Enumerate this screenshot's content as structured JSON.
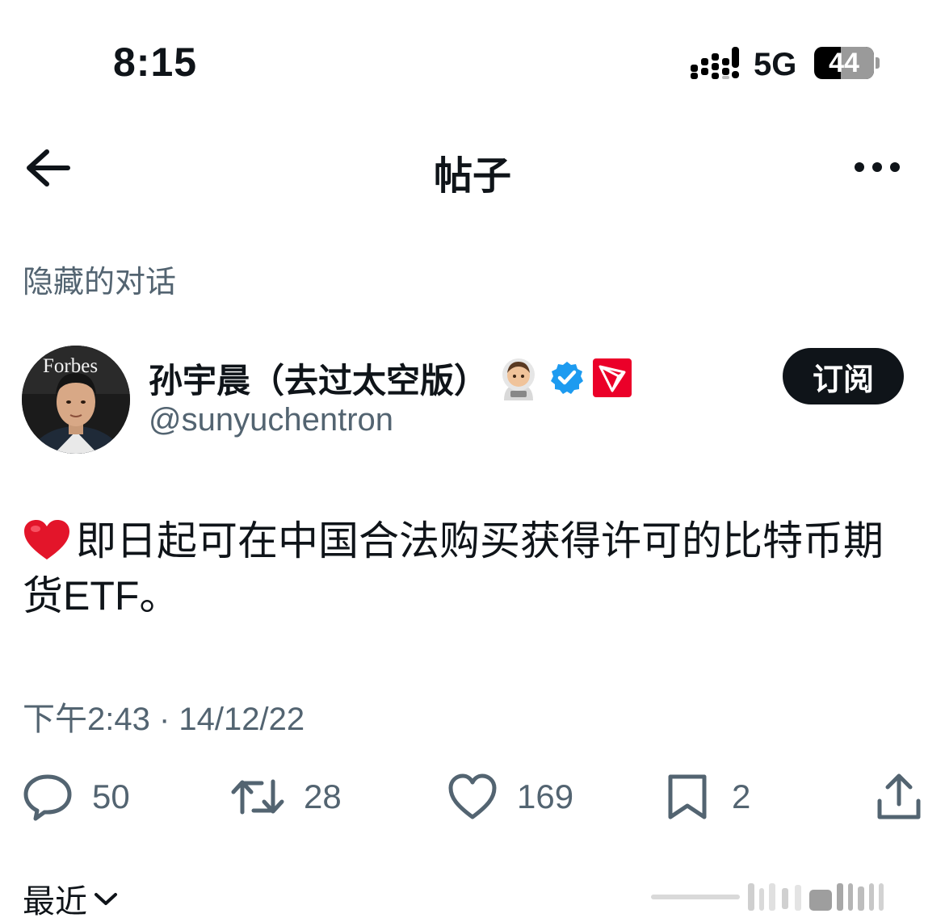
{
  "status_bar": {
    "time": "8:15",
    "network": "5G",
    "battery": "44",
    "battery_level": 0.44
  },
  "header": {
    "title": "帖子"
  },
  "hidden_conversation": "隐藏的对话",
  "author": {
    "name": "孙宇晨（去过太空版）",
    "handle": "@sunyuchentron",
    "avatar_text": "Forbes",
    "subscribe_label": "订阅",
    "verified_color": "#1d9bf0",
    "tron_color": "#eb0029"
  },
  "tweet": {
    "text": "即日起可在中国合法购买获得许可的比特币期货ETF。",
    "timestamp": "下午2:43 · 14/12/22"
  },
  "actions": {
    "replies": "50",
    "retweets": "28",
    "likes": "169",
    "bookmarks": "2"
  },
  "footer": {
    "sort_label": "最近"
  },
  "icons": [
    "back-arrow-icon",
    "more-icon",
    "reply-icon",
    "retweet-icon",
    "like-icon",
    "bookmark-icon",
    "share-icon",
    "chevron-down-icon",
    "astronaut-emoji-icon",
    "verified-badge-icon",
    "tron-logo-icon",
    "heart-emoji-icon",
    "signal-icon",
    "battery-icon"
  ]
}
